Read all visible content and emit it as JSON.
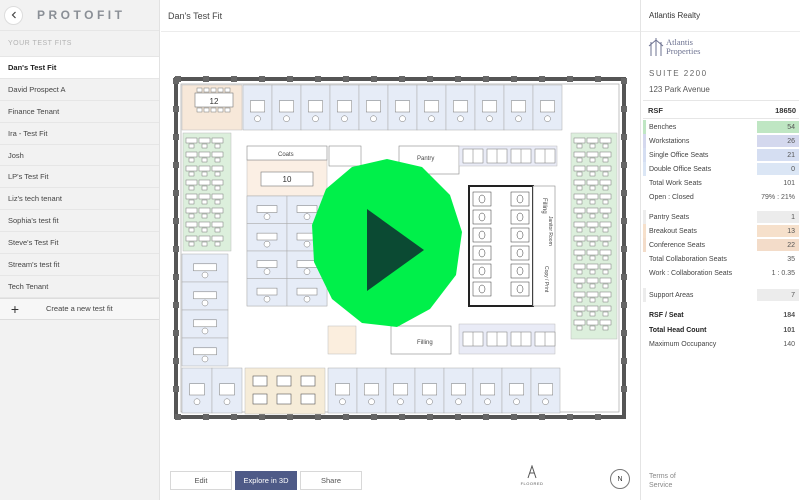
{
  "sidebar": {
    "logo": "PROTOFIT",
    "section_title": "YOUR TEST FITS",
    "fits": [
      "Dan's Test Fit",
      "David Prospect A",
      "Finance Tenant",
      "Ira - Test Fit",
      "Josh",
      "LP's Test Fit",
      "Liz's tech tenant",
      "Sophia's test fit",
      "Steve's Test Fit",
      "Stream's test fit",
      "Tech Tenant"
    ],
    "active_fit": "Dan's Test Fit",
    "create_label": "Create a new test fit"
  },
  "main": {
    "title": "Dan's Test Fit",
    "room_labels": {
      "conf_small": "12",
      "conf_large": "10",
      "coats": "Coats",
      "pantry": "Pantry",
      "filling_right": "Filling",
      "filling_bottom": "Filling",
      "copy_print": "Copy / Print",
      "janitor": "Janitor Room"
    },
    "toolbar": {
      "edit": "Edit",
      "explore": "Explore in 3D",
      "share": "Share"
    },
    "footer_logo": "FLOORED",
    "compass": "N"
  },
  "panel": {
    "company": "Atlantis Realty",
    "brand": [
      "Atlantis",
      "Properties"
    ],
    "suite": "SUITE 2200",
    "address": "123 Park Avenue",
    "rsf_label": "RSF",
    "rsf_value": "18650",
    "stats": [
      {
        "label": "Benches",
        "value": "54",
        "color": "#bfe6c3"
      },
      {
        "label": "Workstations",
        "value": "26",
        "color": "#d4d8ee"
      },
      {
        "label": "Single Office Seats",
        "value": "21",
        "color": "#d5def2"
      },
      {
        "label": "Double Office Seats",
        "value": "0",
        "color": "#dbe6f5"
      },
      {
        "label": "Total Work Seats",
        "value": "101",
        "color": ""
      },
      {
        "label": "Open : Closed",
        "value": "79% : 21%",
        "color": ""
      },
      {
        "label": "Pantry Seats",
        "value": "1",
        "color": "#ececec"
      },
      {
        "label": "Breakout Seats",
        "value": "13",
        "color": "#f6e0cb"
      },
      {
        "label": "Conference Seats",
        "value": "22",
        "color": "#f3dcc9"
      },
      {
        "label": "Total Collaboration Seats",
        "value": "35",
        "color": ""
      },
      {
        "label": "Work : Collaboration Seats",
        "value": "1 : 0.35",
        "color": ""
      },
      {
        "label": "Support Areas",
        "value": "7",
        "color": "#ececec"
      },
      {
        "label": "RSF / Seat",
        "value": "184",
        "color": ""
      },
      {
        "label": "Total Head Count",
        "value": "101",
        "color": ""
      },
      {
        "label": "Maximum Occupancy",
        "value": "140",
        "color": ""
      }
    ],
    "terms": "Terms of Service"
  }
}
